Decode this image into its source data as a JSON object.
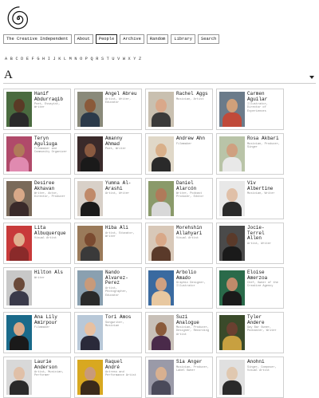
{
  "nav": {
    "items": [
      "The Creative Independent",
      "About",
      "People",
      "Archive",
      "Random",
      "Library",
      "Search"
    ],
    "active": "People"
  },
  "alphabet": [
    "A",
    "B",
    "C",
    "D",
    "E",
    "F",
    "G",
    "H",
    "I",
    "J",
    "K",
    "L",
    "M",
    "N",
    "O",
    "P",
    "Q",
    "R",
    "S",
    "T",
    "U",
    "V",
    "W",
    "X",
    "Y",
    "Z"
  ],
  "section_letter": "A",
  "people": [
    {
      "name": "Hanif Abdurraqib",
      "desc": "Poet, Essayist, Writer",
      "bg": "#4a6b3f",
      "skin": "#5a3a26",
      "cloth": "#2a2a2a"
    },
    {
      "name": "Angel Abreu",
      "desc": "Artist, Writer, Educator",
      "bg": "#8a8a7a",
      "skin": "#8a5a3a",
      "cloth": "#2b3a4a"
    },
    {
      "name": "Rachel Aggs",
      "desc": "Musician, Artist",
      "bg": "#c9c0b0",
      "skin": "#d9a88a",
      "cloth": "#3a3a3a"
    },
    {
      "name": "Carmen Aguilar",
      "desc": "Illustrator, Director of Experiences",
      "bg": "#6b7b8a",
      "skin": "#cfa07a",
      "cloth": "#c04a3a"
    },
    {
      "name": "Teryn Aguliuga",
      "desc": "Filmmaker and Community Organizer",
      "bg": "#b04a6a",
      "skin": "#b07a5a",
      "cloth": "#e08ab0"
    },
    {
      "name": "Amanny Ahmad",
      "desc": "Poet, Writer",
      "bg": "#3a2a2a",
      "skin": "#8a5a40",
      "cloth": "#1a1a1a"
    },
    {
      "name": "Andrew Ahn",
      "desc": "Filmmaker",
      "bg": "#e0d8c8",
      "skin": "#d9b08a",
      "cloth": "#2a2a2a"
    },
    {
      "name": "Rosa Akbari",
      "desc": "Musician, Producer, Singer",
      "bg": "#b9c4a8",
      "skin": "#cfa080",
      "cloth": "#e8e8e8"
    },
    {
      "name": "Desiree Akhavan",
      "desc": "Writer, Actor, Director, Producer",
      "bg": "#7a6a5a",
      "skin": "#d8a888",
      "cloth": "#3a2a2a"
    },
    {
      "name": "Yumna Al-Arashi",
      "desc": "Artist, Writer",
      "bg": "#d8d0c8",
      "skin": "#c08a6a",
      "cloth": "#1a1a1a"
    },
    {
      "name": "Daniel Alarcón",
      "desc": "Writer, Podcast Producer, Editor",
      "bg": "#8a9a6a",
      "skin": "#b07a5a",
      "cloth": "#d8d8d8"
    },
    {
      "name": "Viv Albertine",
      "desc": "Musician, Writer",
      "bg": "#e8e8e8",
      "skin": "#e0c0a8",
      "cloth": "#2a2a2a"
    },
    {
      "name": "Lita Albuquerque",
      "desc": "Visual Artist",
      "bg": "#c83a3a",
      "skin": "#e0b090",
      "cloth": "#8a2a2a"
    },
    {
      "name": "Hiba Ali",
      "desc": "Artist, Educator, Writer",
      "bg": "#9a7a5a",
      "skin": "#7a4a30",
      "cloth": "#3a3a3a"
    },
    {
      "name": "Morehshin Allahyari",
      "desc": "Visual Artist",
      "bg": "#d8c8b8",
      "skin": "#d8a888",
      "cloth": "#5a3a2a"
    },
    {
      "name": "Jocie-Terrel Allen",
      "desc": "Artist, Writer",
      "bg": "#4a4a4a",
      "skin": "#5a3a2a",
      "cloth": "#1a1a1a"
    },
    {
      "name": "Hilton Als",
      "desc": "Writer",
      "bg": "#c8c8c8",
      "skin": "#6a4a3a",
      "cloth": "#3a3a4a"
    },
    {
      "name": "Nando Alvarez-Perez",
      "desc": "Artist, Photographer, Educator",
      "bg": "#8aa0b0",
      "skin": "#c89a7a",
      "cloth": "#2a2a2a"
    },
    {
      "name": "Arbolio Amado",
      "desc": "Graphic Designer, Illustrator",
      "bg": "#3a6aa0",
      "skin": "#d0a080",
      "cloth": "#e8c8a0"
    },
    {
      "name": "Eloise Amerzoa",
      "desc": "Chef, Owner of the Creative Agency",
      "bg": "#2a6a4a",
      "skin": "#c08a6a",
      "cloth": "#1a1a1a"
    },
    {
      "name": "Ana Lily Amirpour",
      "desc": "Filmmaker",
      "bg": "#1a6a8a",
      "skin": "#d8a888",
      "cloth": "#1a1a1a"
    },
    {
      "name": "Tori Amos",
      "desc": "Songwriter, Musician",
      "bg": "#b8c8d8",
      "skin": "#e8c0a0",
      "cloth": "#2a2a3a"
    },
    {
      "name": "Suzi Analogue",
      "desc": "Musician, Producer, Designer, Recording Artist",
      "bg": "#c8c0b8",
      "skin": "#8a5a3a",
      "cloth": "#4a2a4a"
    },
    {
      "name": "Tyler Andere",
      "desc": "Gay Bar Owner, Podcaster, Writer",
      "bg": "#3a4a2a",
      "skin": "#6a4030",
      "cloth": "#c8a040"
    },
    {
      "name": "Laurie Anderson",
      "desc": "Artist, Musician, Performer",
      "bg": "#d8d8d8",
      "skin": "#e0c0a8",
      "cloth": "#2a2a2a"
    },
    {
      "name": "Raquel André",
      "desc": "Actress and Performance Artist",
      "bg": "#d8a820",
      "skin": "#c89a7a",
      "cloth": "#3a2a1a"
    },
    {
      "name": "Sia Anger",
      "desc": "Musician, Producer, Label Owner",
      "bg": "#9a9aa8",
      "skin": "#d8b090",
      "cloth": "#4a4a5a"
    },
    {
      "name": "Anohni",
      "desc": "Singer, Composer, Visual Artist",
      "bg": "#e0e0e0",
      "skin": "#e0c8b0",
      "cloth": "#2a2a2a"
    }
  ]
}
